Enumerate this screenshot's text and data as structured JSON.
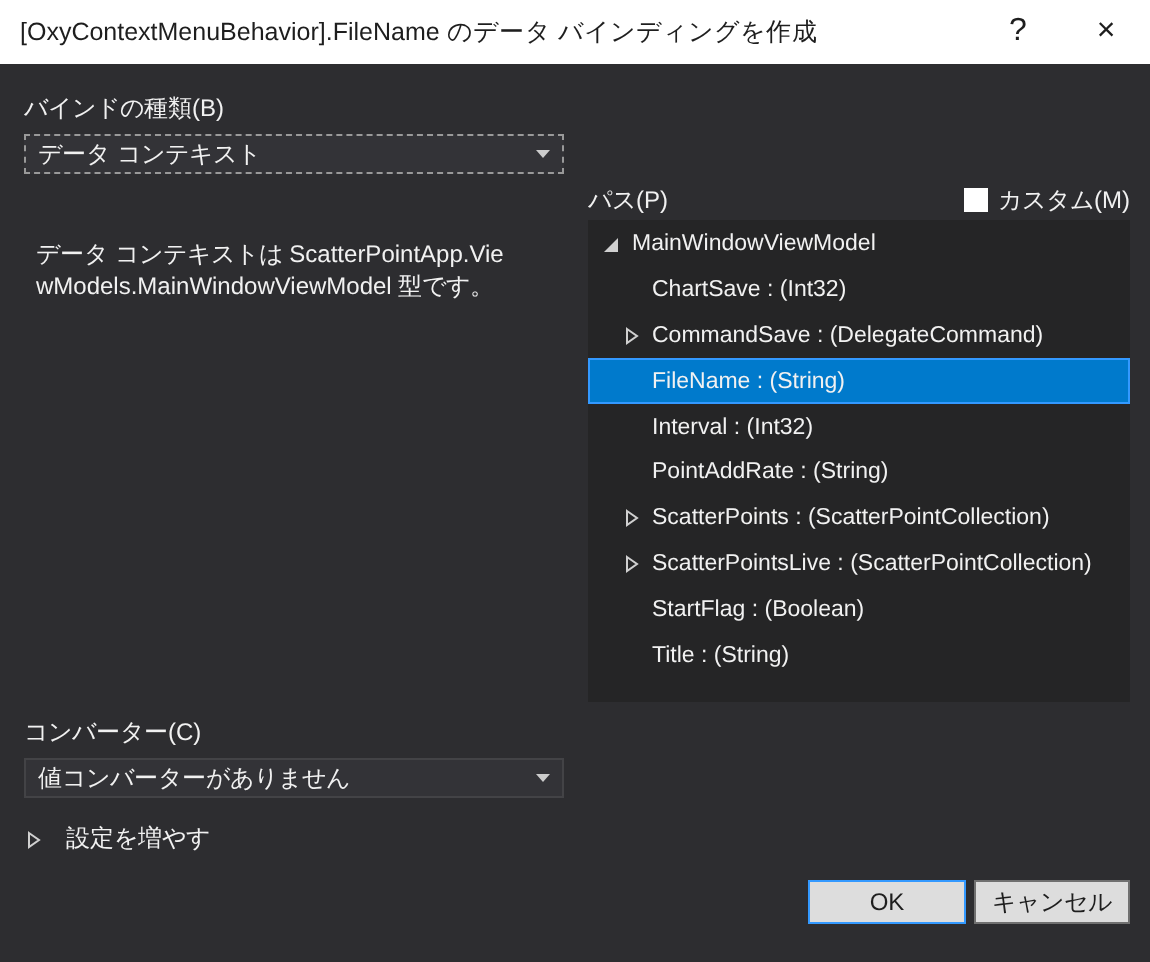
{
  "window": {
    "title": "[OxyContextMenuBehavior].FileName のデータ バインディングを作成",
    "help": "?",
    "close": "×"
  },
  "bind_type": {
    "label": "バインドの種類(B)",
    "value": "データ コンテキスト"
  },
  "description": "データ コンテキストは ScatterPointApp.ViewModels.MainWindowViewModel 型です。",
  "path": {
    "label": "パス(P)",
    "custom": {
      "label": "カスタム(M)",
      "checked": false
    },
    "tree": [
      {
        "label": "MainWindowViewModel",
        "kind": "group",
        "expanded": true,
        "selected": false,
        "children": [
          {
            "label": "ChartSave : (Int32)",
            "kind": "leaf",
            "selected": false
          },
          {
            "label": "CommandSave : (DelegateCommand)",
            "kind": "group",
            "expanded": false,
            "selected": false
          },
          {
            "label": "FileName : (String)",
            "kind": "leaf",
            "selected": true
          },
          {
            "label": "Interval : (Int32)",
            "kind": "leaf",
            "selected": false
          },
          {
            "label": "PointAddRate : (String)",
            "kind": "leaf",
            "selected": false
          },
          {
            "label": "ScatterPoints : (ScatterPointCollection)",
            "kind": "group",
            "expanded": false,
            "selected": false
          },
          {
            "label": "ScatterPointsLive : (ScatterPointCollection)",
            "kind": "group",
            "expanded": false,
            "selected": false
          },
          {
            "label": "StartFlag : (Boolean)",
            "kind": "leaf",
            "selected": false
          },
          {
            "label": "Title : (String)",
            "kind": "leaf",
            "selected": false
          }
        ]
      }
    ]
  },
  "converter": {
    "label": "コンバーター(C)",
    "value": "値コンバーターがありません"
  },
  "more_settings": {
    "label": "設定を増やす",
    "expanded": false
  },
  "buttons": [
    {
      "label": "OK",
      "kind": "default"
    },
    {
      "label": "キャンセル",
      "kind": "normal"
    }
  ]
}
